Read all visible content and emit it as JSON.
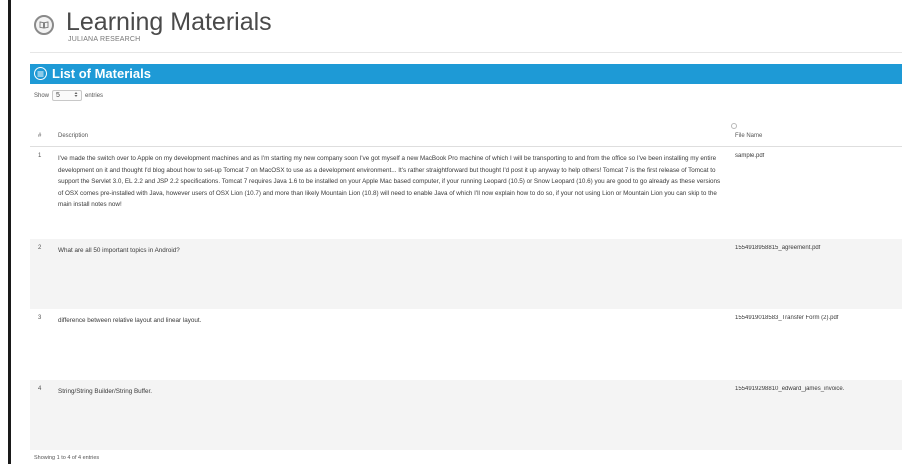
{
  "header": {
    "title": "Learning Materials",
    "subtitle": "JULIANA RESEARCH",
    "icon": "book-icon"
  },
  "panel": {
    "title": "List of Materials",
    "icon": "list-icon",
    "color": "#1e9ad6"
  },
  "length_menu": {
    "prefix": "Show",
    "value": "5",
    "suffix": "entries"
  },
  "table": {
    "columns": [
      "#",
      "Description",
      "File Name"
    ],
    "rows": [
      {
        "num": "1",
        "description": "I've made the switch over to Apple on my development machines and as I'm starting my new company soon I've got myself a new MacBook Pro machine of which I will be transporting to and from the office so I've been installing my entire development on it and thought I'd blog about how to set-up Tomcat 7 on MacOSX to use as a development environment... It's rather straightforward but thought I'd post it up anyway to help others! Tomcat 7 is the first release of Tomcat to support the Servlet 3.0, EL 2.2 and JSP 2.2 specifications. Tomcat 7 requires Java 1.6 to be installed on your Apple Mac based computer, if your running Leopard (10.5) or Snow Leopard (10.6) you are good to go already as these versions of OSX comes pre-installed with Java, however users of OSX Lion (10.7) and more than likely Mountain Lion (10.8) will need to enable Java of which I'll now explain how to do so, if your not using Lion or Mountain Lion you can skip to the main install notes now!",
        "file": "sample.pdf"
      },
      {
        "num": "2",
        "description": "What are all 50 important topics in Android?",
        "file": "1554918958815_agreement.pdf"
      },
      {
        "num": "3",
        "description": "difference between relative layout and linear layout.",
        "file": "1554919018583_Transfer Form (2).pdf"
      },
      {
        "num": "4",
        "description": "String/String Builder/String Buffer.",
        "file": "1554919298810_edward_james_invoice."
      }
    ]
  },
  "footer": {
    "info": "Showing 1 to 4 of 4 entries"
  }
}
